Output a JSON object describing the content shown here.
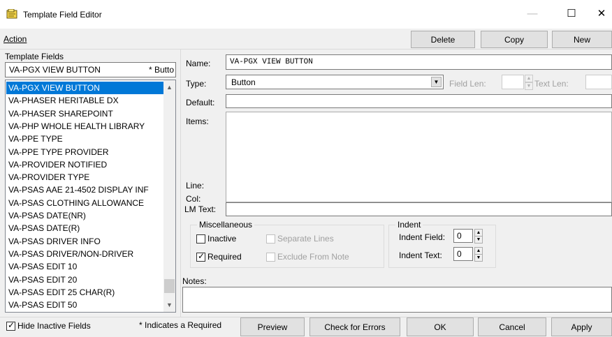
{
  "window": {
    "title": "Template Field Editor",
    "minimize": "—",
    "maximize": "☐",
    "close": "✕"
  },
  "menu": {
    "action": "Action"
  },
  "toolbar": {
    "delete": "Delete",
    "copy": "Copy",
    "new": "New"
  },
  "left": {
    "label": "Template Fields",
    "header_name": "VA-PGX VIEW BUTTON",
    "header_flag": "* Butto",
    "selected_index": 0,
    "items": [
      "VA-PGX VIEW BUTTON",
      "VA-PHASER HERITABLE DX",
      "VA-PHASER SHAREPOINT",
      "VA-PHP WHOLE HEALTH LIBRARY",
      "VA-PPE TYPE",
      "VA-PPE TYPE PROVIDER",
      "VA-PROVIDER NOTIFIED",
      "VA-PROVIDER TYPE",
      "VA-PSAS AAE 21-4502 DISPLAY INF",
      "VA-PSAS CLOTHING ALLOWANCE",
      "VA-PSAS DATE(NR)",
      "VA-PSAS DATE(R)",
      "VA-PSAS DRIVER INFO",
      "VA-PSAS DRIVER/NON-DRIVER",
      "VA-PSAS EDIT 10",
      "VA-PSAS EDIT 20",
      "VA-PSAS EDIT 25 CHAR(R)",
      "VA-PSAS EDIT 50"
    ],
    "hide_inactive": "Hide Inactive Fields",
    "required_note": "* Indicates a Required"
  },
  "form": {
    "name_label": "Name:",
    "name_value": "VA-PGX VIEW BUTTON",
    "type_label": "Type:",
    "type_value": "Button",
    "field_len_label": "Field Len:",
    "text_len_label": "Text Len:",
    "default_label": "Default:",
    "items_label": "Items:",
    "line_label": "Line:",
    "col_label": "Col:",
    "lm_text_label": "LM Text:",
    "misc_title": "Miscellaneous",
    "inactive_label": "Inactive",
    "inactive_checked": false,
    "required_label": "Required",
    "required_checked": true,
    "separate_lines_label": "Separate Lines",
    "exclude_label": "Exclude From Note",
    "indent_title": "Indent",
    "indent_field_label": "Indent Field:",
    "indent_field_value": "0",
    "indent_text_label": "Indent Text:",
    "indent_text_value": "0",
    "notes_label": "Notes:"
  },
  "bottom": {
    "preview": "Preview",
    "check_errors": "Check for Errors",
    "ok": "OK",
    "cancel": "Cancel",
    "apply": "Apply"
  },
  "colors": {
    "selection": "#0078d7",
    "panel": "#f0f0f0",
    "button": "#e1e1e1"
  }
}
